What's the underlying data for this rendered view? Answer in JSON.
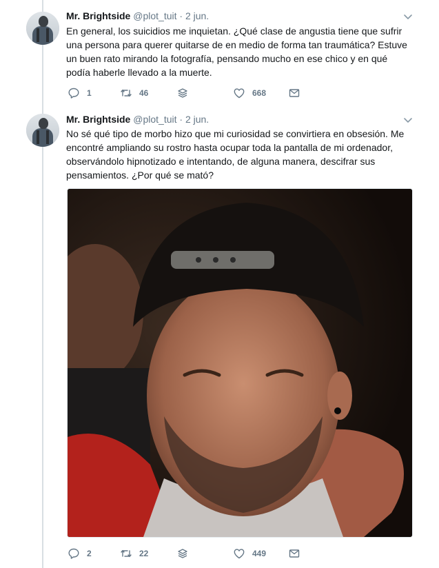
{
  "tweets": [
    {
      "author_name": "Mr. Brightside",
      "handle": "@plot_tuit",
      "separator": "·",
      "date": "2 jun.",
      "text_lines": [
        "En general, los suicidios me inquietan. ¿Qué clase de angustia tiene que sufrir",
        "una persona para querer quitarse de en medio de forma tan traumática? Estuve",
        "un buen rato mirando la fotografía, pensando mucho en ese chico y en qué",
        "podía haberle llevado a la muerte."
      ],
      "replies": "1",
      "retweets": "46",
      "likes": "668"
    },
    {
      "author_name": "Mr. Brightside",
      "handle": "@plot_tuit",
      "separator": "·",
      "date": "2 jun.",
      "text_lines": [
        "No sé qué tipo de morbo hizo que mi curiosidad se convirtiera en obsesión. Me",
        "encontré ampliando su rostro hasta ocupar toda la pantalla de mi ordenador,",
        "observándolo hipnotizado e intentando, de alguna manera, descifrar sus",
        "pensamientos. ¿Por qué se mató?"
      ],
      "replies": "2",
      "retweets": "22",
      "likes": "449"
    }
  ],
  "icons": {
    "reply": "reply-icon",
    "retweet": "retweet-icon",
    "analytics": "analytics-icon",
    "like": "heart-icon",
    "message": "direct-message-icon",
    "caret": "chevron-down-icon"
  },
  "colors": {
    "text": "#14171a",
    "secondary": "#657786",
    "thread_line": "#d8dee3"
  }
}
